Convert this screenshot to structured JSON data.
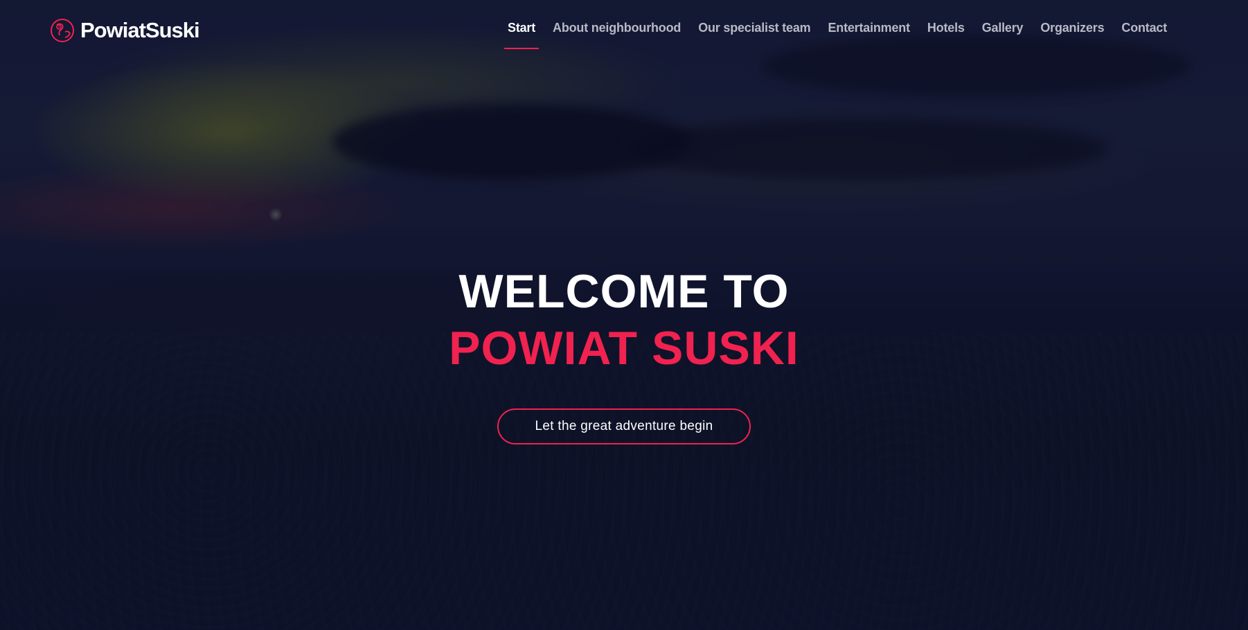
{
  "brand": {
    "name": "PowiatSuski",
    "accent_color": "#f1224f",
    "logo_icon": "map-pin-globe-icon"
  },
  "nav": {
    "items": [
      {
        "label": "Start",
        "active": true
      },
      {
        "label": "About neighbourhood",
        "active": false
      },
      {
        "label": "Our specialist team",
        "active": false
      },
      {
        "label": "Entertainment",
        "active": false
      },
      {
        "label": "Hotels",
        "active": false
      },
      {
        "label": "Gallery",
        "active": false
      },
      {
        "label": "Organizers",
        "active": false
      },
      {
        "label": "Contact",
        "active": false
      }
    ]
  },
  "hero": {
    "title_line1": "WELCOME TO",
    "title_line2": "POWIAT SUSKI",
    "cta_label": "Let the great adventure begin"
  }
}
